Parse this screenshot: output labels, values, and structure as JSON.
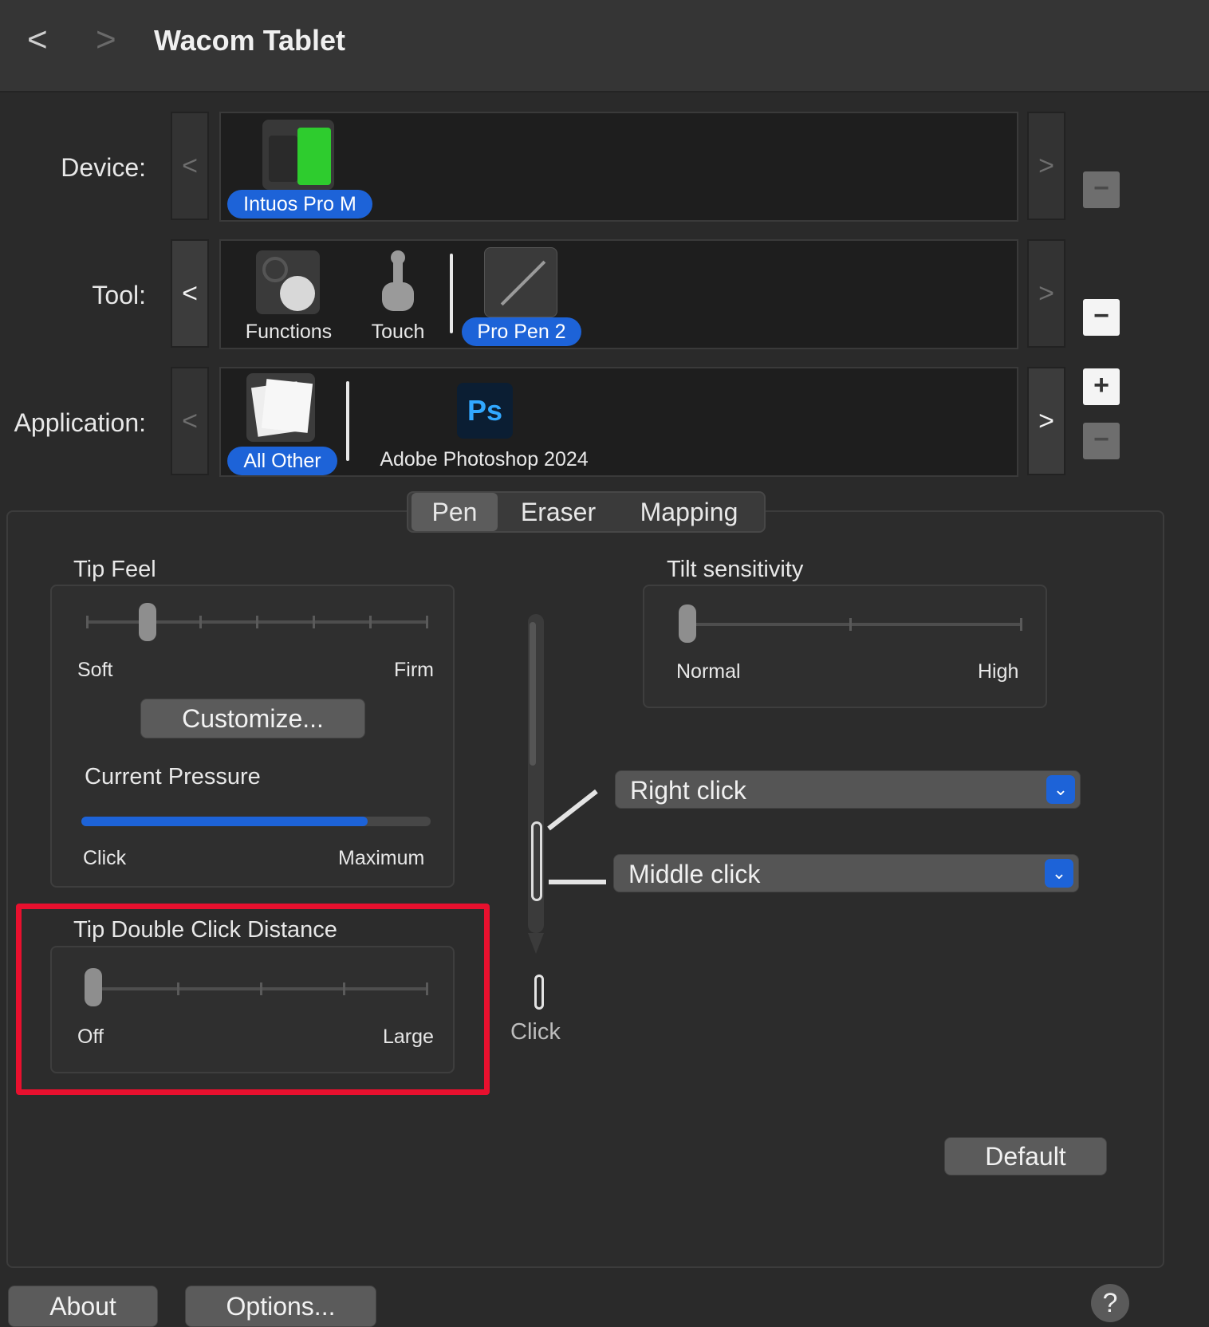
{
  "window": {
    "title": "Wacom Tablet",
    "back_icon": "<",
    "forward_icon": ">"
  },
  "device": {
    "label": "Device:",
    "items": [
      {
        "name": "Intuos Pro M",
        "selected": true
      }
    ],
    "prev": "<",
    "next": ">",
    "remove": "−"
  },
  "tool": {
    "label": "Tool:",
    "items": [
      {
        "name": "Functions",
        "selected": false
      },
      {
        "name": "Touch",
        "selected": false
      },
      {
        "name": "Pro Pen 2",
        "selected": true
      }
    ],
    "prev": "<",
    "next": ">",
    "remove": "−"
  },
  "application": {
    "label": "Application:",
    "items": [
      {
        "name": "All Other",
        "selected": true
      },
      {
        "name": "Adobe Photoshop 2024",
        "selected": false,
        "icon_text": "Ps"
      }
    ],
    "prev": "<",
    "next": ">",
    "add": "+",
    "remove": "−"
  },
  "tabs": [
    {
      "label": "Pen",
      "selected": true
    },
    {
      "label": "Eraser",
      "selected": false
    },
    {
      "label": "Mapping",
      "selected": false
    }
  ],
  "tip_feel": {
    "title": "Tip Feel",
    "min_label": "Soft",
    "max_label": "Firm",
    "level": 0.18,
    "customize_label": "Customize...",
    "pressure_title": "Current Pressure",
    "pressure_level": 0.82,
    "pressure_min": "Click",
    "pressure_max": "Maximum"
  },
  "tilt": {
    "title": "Tilt sensitivity",
    "min_label": "Normal",
    "max_label": "High",
    "level": 0
  },
  "pen_buttons": {
    "upper": "Right click",
    "lower": "Middle click",
    "tip": "Click"
  },
  "double_click": {
    "title": "Tip Double Click Distance",
    "min_label": "Off",
    "max_label": "Large",
    "level": 0
  },
  "default_label": "Default",
  "footer": {
    "about": "About",
    "options": "Options...",
    "help": "?"
  },
  "colors": {
    "accent": "#1d63d8",
    "highlight": "#e8102e",
    "background": "#2a2a2a"
  }
}
